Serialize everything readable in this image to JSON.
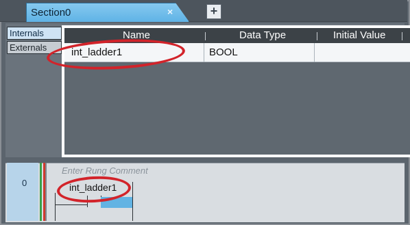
{
  "tab": {
    "label": "Section0",
    "close_glyph": "×",
    "add_glyph": "+"
  },
  "side_tabs": {
    "internals": "Internals",
    "externals": "Externals"
  },
  "table": {
    "columns": [
      "Name",
      "Data Type",
      "Initial Value"
    ],
    "rows": [
      {
        "name": "int_ladder1",
        "type": "BOOL",
        "initial": ""
      }
    ]
  },
  "ladder": {
    "rung_number": "0",
    "comment_placeholder": "Enter Rung Comment",
    "contact_label": "int_ladder1"
  },
  "colors": {
    "tab": "#6fbde9",
    "annotation": "#d2232a",
    "rail_green": "#39a24a",
    "rail_red": "#d13b2e"
  }
}
